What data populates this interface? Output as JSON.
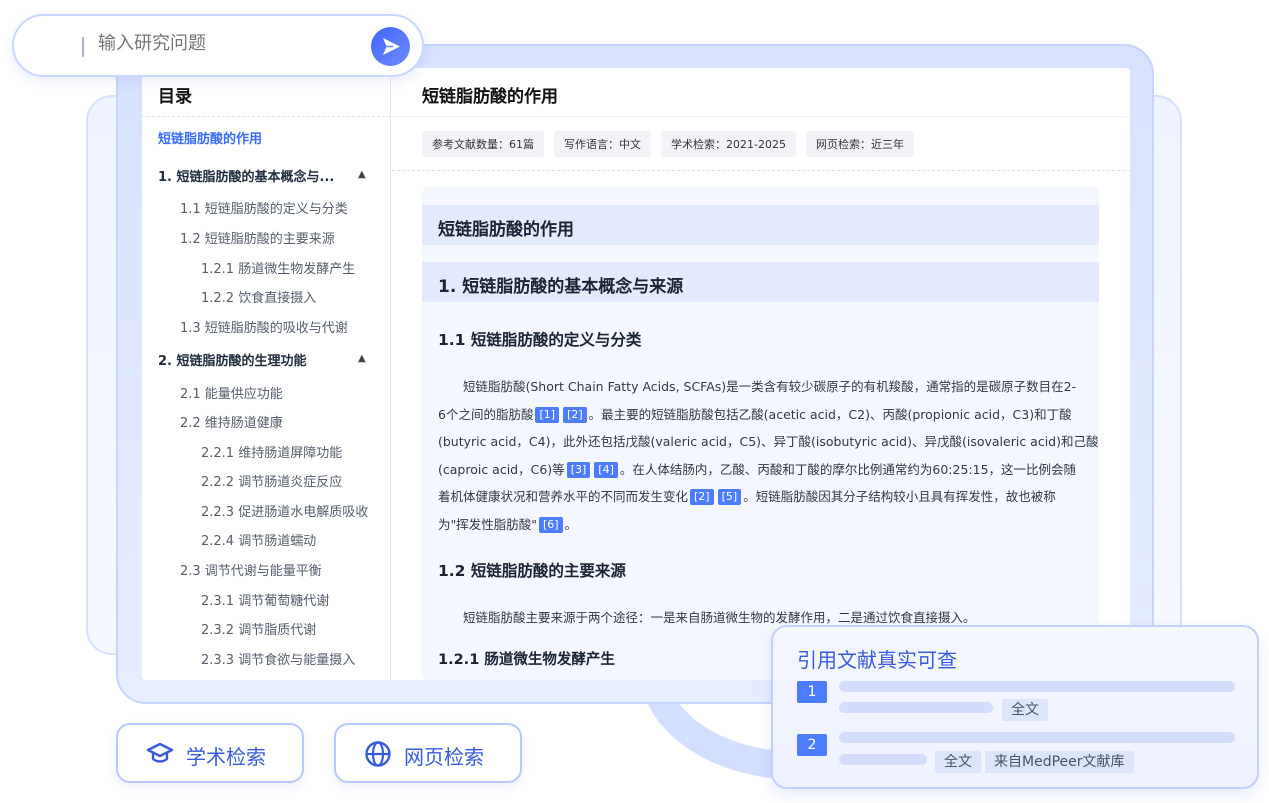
{
  "search": {
    "placeholder": "输入研究问题"
  },
  "sidebar": {
    "title": "目录",
    "root": "短链脂肪酸的作用",
    "items": [
      {
        "label": "1.  短链脂肪酸的基本概念与...",
        "level": 1,
        "expanded": true
      },
      {
        "label": "1.1 短链脂肪酸的定义与分类",
        "level": 2
      },
      {
        "label": "1.2 短链脂肪酸的主要来源",
        "level": 2
      },
      {
        "label": "1.2.1 肠道微生物发酵产生",
        "level": 3
      },
      {
        "label": "1.2.2 饮食直接摄入",
        "level": 3
      },
      {
        "label": "1.3 短链脂肪酸的吸收与代谢",
        "level": 2
      },
      {
        "label": "2.  短链脂肪酸的生理功能",
        "level": 1,
        "expanded": true
      },
      {
        "label": "2.1 能量供应功能",
        "level": 2
      },
      {
        "label": "2.2 维持肠道健康",
        "level": 2
      },
      {
        "label": "2.2.1 维持肠道屏障功能",
        "level": 3
      },
      {
        "label": "2.2.2 调节肠道炎症反应",
        "level": 3
      },
      {
        "label": "2.2.3 促进肠道水电解质吸收",
        "level": 3
      },
      {
        "label": "2.2.4 调节肠道蠕动",
        "level": 3
      },
      {
        "label": "2.3 调节代谢与能量平衡",
        "level": 2
      },
      {
        "label": "2.3.1 调节葡萄糖代谢",
        "level": 3
      },
      {
        "label": "2.3.2 调节脂质代谢",
        "level": 3
      },
      {
        "label": "2.3.3 调节食欲与能量摄入",
        "level": 3
      }
    ],
    "caret": "▲"
  },
  "document": {
    "title": "短链脂肪酸的作用",
    "tags": [
      "参考文献数量：61篇",
      "写作语言：中文",
      "学术检索：2021-2025",
      "网页检索：近三年"
    ],
    "heading_main": "短链脂肪酸的作用",
    "heading_1": "1. 短链脂肪酸的基本概念与来源",
    "heading_1_1": "1.1 短链脂肪酸的定义与分类",
    "para_1": {
      "l1": "短链脂肪酸(Short Chain Fatty Acids, SCFAs)是一类含有较少碳原子的有机羧酸，通常指的是碳原子数目在2-",
      "l2a": "6个之间的脂肪酸",
      "l2b": "。最主要的短链脂肪酸包括乙酸(acetic acid，C2)、丙酸(propionic acid，C3)和丁酸",
      "l3": "(butyric acid，C4)，此外还包括戊酸(valeric acid，C5)、异丁酸(isobutyric acid)、异戊酸(isovaleric acid)和己酸",
      "l4a": "(caproic acid，C6)等",
      "l4b": "。在人体结肠内，乙酸、丙酸和丁酸的摩尔比例通常约为60:25:15，这一比例会随",
      "l5a": "着机体健康状况和营养水平的不同而发生变化",
      "l5b": "。短链脂肪酸因其分子结构较小且具有挥发性，故也被称",
      "l6a": "为\"挥发性脂肪酸\"",
      "l6b": "。"
    },
    "citations": [
      "[1]",
      "[2]",
      "[3]",
      "[4]",
      "[2]",
      "[5]",
      "[6]"
    ],
    "heading_1_2": "1.2 短链脂肪酸的主要来源",
    "para_2": "短链脂肪酸主要来源于两个途径：一是来自肠道微生物的发酵作用，二是通过饮食直接摄入。",
    "heading_1_2_1": "1.2.1 肠道微生物发酵产生"
  },
  "buttons": {
    "academic": "学术检索",
    "web": "网页检索"
  },
  "citation_card": {
    "title": "引用文献真实可查",
    "items": [
      {
        "num": "1",
        "tags": [
          "全文"
        ]
      },
      {
        "num": "2",
        "tags": [
          "全文",
          "来自MedPeer文献库"
        ]
      }
    ]
  },
  "colors": {
    "accent": "#4c7dff",
    "brand_text": "#3a5bd9",
    "highlight_band": "#e3eafd"
  }
}
